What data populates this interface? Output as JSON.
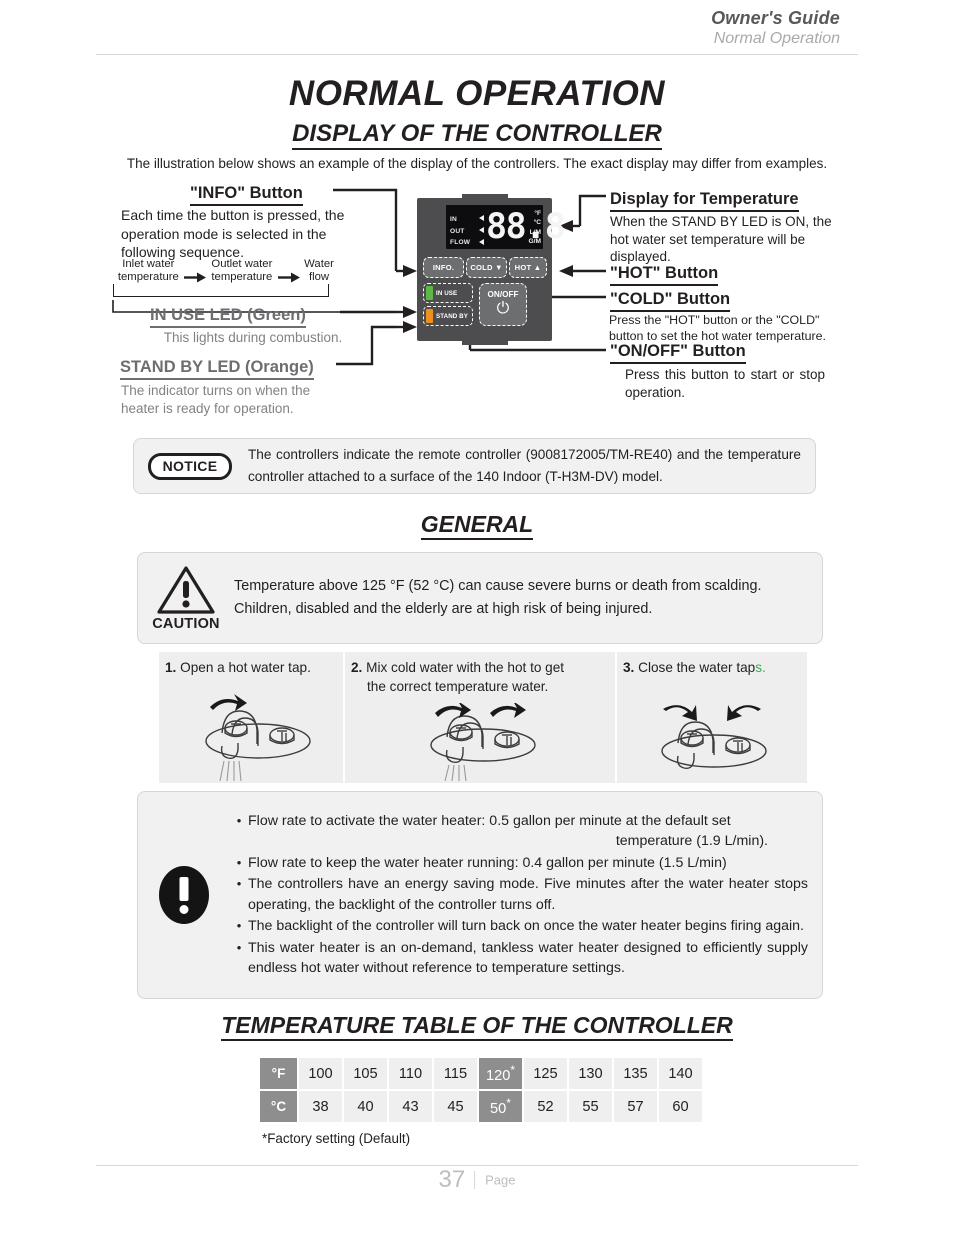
{
  "header": {
    "guide_title": "Owner's Guide",
    "section": "Normal Operation"
  },
  "titles": {
    "main": "NORMAL OPERATION",
    "sub": "DISPLAY OF THE CONTROLLER",
    "general": "GENERAL",
    "temp_table": "TEMPERATURE TABLE OF THE CONTROLLER"
  },
  "intro": "The illustration below shows an example of the display of the controllers.  The exact display may differ from examples.",
  "controller": {
    "lcd": {
      "row_labels": [
        "IN",
        "OUT",
        "FLOW"
      ],
      "digits": "88.8",
      "units": [
        "°F",
        "°C",
        "L/M",
        "G/M"
      ]
    },
    "buttons": {
      "info": "INFO.",
      "cold": "COLD ▼",
      "hot": "HOT ▲",
      "onoff": "ON/OFF"
    },
    "leds": {
      "in_use": "IN USE",
      "stand_by": "STAND BY",
      "in_use_color": "#5cb947",
      "stand_by_color": "#f0901e"
    }
  },
  "annotations": {
    "info_button": {
      "heading": "\"INFO\" Button",
      "body": "Each time the button is pressed, the operation mode is selected in the following sequence.",
      "sequence": [
        "Inlet water temperature",
        "Outlet water temperature",
        "Water flow"
      ]
    },
    "in_use_led": {
      "heading": "IN USE LED (Green)",
      "body": "This lights during combustion."
    },
    "stand_by_led": {
      "heading": "STAND BY LED (Orange)",
      "body": "The indicator turns on when the heater is ready for operation."
    },
    "display_temperature": {
      "heading": "Display for Temperature",
      "body": "When the STAND BY LED is ON, the hot water set temperature will be displayed."
    },
    "hot_button": {
      "heading": "\"HOT\" Button"
    },
    "cold_button": {
      "heading": "\"COLD\" Button",
      "body": "Press the \"HOT\" button or the \"COLD\" button to set the hot water temperature."
    },
    "onoff_button": {
      "heading": "\"ON/OFF\" Button",
      "body": "Press this button to start or stop operation."
    }
  },
  "notice": {
    "badge": "NOTICE",
    "text": "The controllers indicate the remote controller (9008172005/TM-RE40) and the temperature controller attached to a surface of the 140 Indoor (T-H3M-DV) model."
  },
  "caution": {
    "label": "CAUTION",
    "line1": "Temperature above 125 °F (52 °C) can cause severe burns or death from scalding.",
    "line2": "Children, disabled and the elderly are at high risk of being injured."
  },
  "steps": [
    {
      "number": "1.",
      "text": "Open a hot water tap.",
      "indent": ""
    },
    {
      "number": "2.",
      "text": "Mix cold water with the hot to get",
      "indent": "the correct temperature water."
    },
    {
      "number": "3.",
      "text": "Close the water tap",
      "suffix": "s.",
      "suffix_color": "#3faa5a",
      "indent": ""
    }
  ],
  "info_notes": [
    {
      "text": "Flow rate to activate the water heater: 0.5 gallon per minute at the default set",
      "second_line": "temperature (1.9 L/min)."
    },
    {
      "text": "Flow rate to keep the water heater running: 0.4 gallon per minute (1.5 L/min)"
    },
    {
      "text": "The controllers have an energy saving mode.  Five minutes after the water heater stops operating, the backlight of the controller turns off."
    },
    {
      "text": "The backlight of the controller will turn back on once the water heater begins firing again."
    },
    {
      "text": "This water heater is an on-demand, tankless water heater designed to efficiently supply endless hot water without reference to temperature settings."
    }
  ],
  "temp_table": {
    "rows": [
      {
        "unit": "°F",
        "values": [
          "100",
          "105",
          "110",
          "115",
          "120",
          "125",
          "130",
          "135",
          "140"
        ],
        "highlight_index": 4,
        "highlight_star": "*"
      },
      {
        "unit": "°C",
        "values": [
          "38",
          "40",
          "43",
          "45",
          "50",
          "52",
          "55",
          "57",
          "60"
        ],
        "highlight_index": 4,
        "highlight_star": "*"
      }
    ],
    "note": "*Factory setting (Default)"
  },
  "footer": {
    "page_number": "37",
    "page_word": "Page"
  }
}
